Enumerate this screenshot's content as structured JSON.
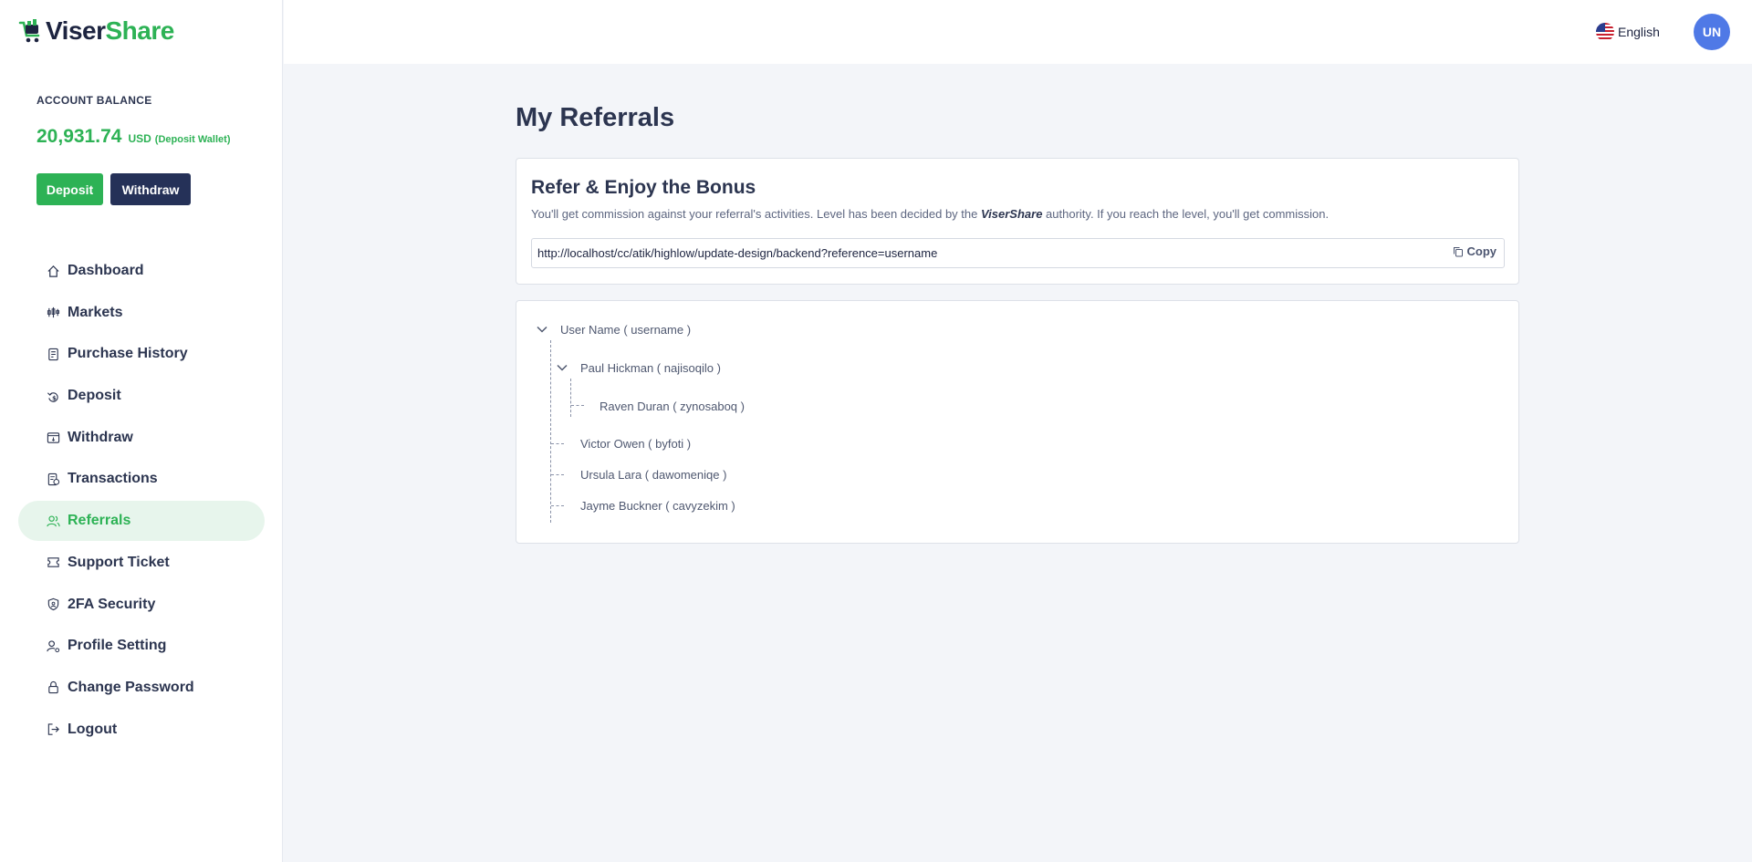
{
  "brand": {
    "name_part1": "Viser",
    "name_part2": "Share"
  },
  "account": {
    "label": "ACCOUNT BALANCE",
    "amount": "20,931.74",
    "currency": "USD",
    "wallet": "(Deposit Wallet)",
    "deposit_label": "Deposit",
    "withdraw_label": "Withdraw"
  },
  "sidebar": {
    "items": [
      {
        "label": "Dashboard",
        "icon": "home-icon"
      },
      {
        "label": "Markets",
        "icon": "markets-icon"
      },
      {
        "label": "Purchase History",
        "icon": "receipt-icon"
      },
      {
        "label": "Deposit",
        "icon": "deposit-icon"
      },
      {
        "label": "Withdraw",
        "icon": "withdraw-icon"
      },
      {
        "label": "Transactions",
        "icon": "transactions-icon"
      },
      {
        "label": "Referrals",
        "icon": "users-icon",
        "active": true
      },
      {
        "label": "Support Ticket",
        "icon": "ticket-icon"
      },
      {
        "label": "2FA Security",
        "icon": "shield-icon"
      },
      {
        "label": "Profile Setting",
        "icon": "user-gear-icon"
      },
      {
        "label": "Change Password",
        "icon": "lock-icon"
      },
      {
        "label": "Logout",
        "icon": "logout-icon"
      }
    ]
  },
  "header": {
    "language": "English",
    "avatar_initials": "UN"
  },
  "page": {
    "title": "My Referrals"
  },
  "refer": {
    "title": "Refer & Enjoy the Bonus",
    "desc_before": "You'll get commission against your referral's activities. Level has been decided by the ",
    "desc_brand": "ViserShare",
    "desc_after": " authority. If you reach the level, you'll get commission.",
    "link": "http://localhost/cc/atik/highlow/update-design/backend?reference=username",
    "copy_label": "Copy"
  },
  "tree": {
    "root": "User Name ( username )",
    "n1": "Paul Hickman ( najisoqilo )",
    "n1_1": "Raven Duran ( zynosaboq )",
    "n2": "Victor Owen ( byfoti )",
    "n3": "Ursula Lara ( dawomeniqe )",
    "n4": "Jayme Buckner ( cavyzekim )"
  },
  "colors": {
    "accent": "#2db255",
    "navy": "#253158",
    "avatar": "#4f79e6",
    "background": "#f3f5f9"
  }
}
